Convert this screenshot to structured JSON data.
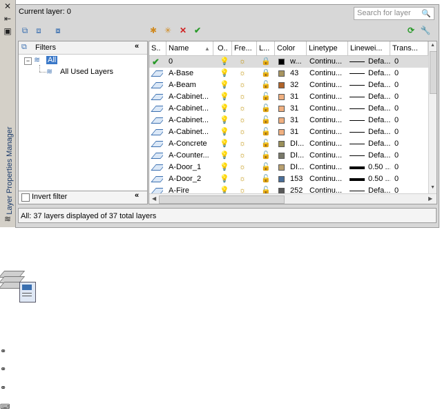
{
  "palette": {
    "title": "Layer Properties Manager",
    "close_icon": "close-icon",
    "autohide_icon": "autohide-icon",
    "properties_icon": "properties-icon"
  },
  "header": {
    "current_layer": "Current layer: 0",
    "search_placeholder": "Search for layer"
  },
  "filters": {
    "title": "Filters",
    "tree": [
      {
        "label": "All"
      },
      {
        "label": "All Used Layers"
      }
    ],
    "invert_filter": "Invert filter"
  },
  "columns": [
    "S..",
    "Name",
    "O..",
    "Fre...",
    "L...",
    "Color",
    "Linetype",
    "Linewei...",
    "Trans..."
  ],
  "layers": [
    {
      "status": "current",
      "name": "0",
      "color_label": "w...",
      "color": "#000000",
      "linetype": "Continu...",
      "lineweight": "Defa...",
      "lw_thick": false,
      "trans": "0",
      "locked": true,
      "selected": true
    },
    {
      "status": "",
      "name": "A-Base",
      "color_label": "43",
      "color": "#a89560",
      "linetype": "Continu...",
      "lineweight": "Defa...",
      "lw_thick": false,
      "trans": "0",
      "locked": true
    },
    {
      "status": "",
      "name": "A-Beam",
      "color_label": "32",
      "color": "#b0642a",
      "linetype": "Continu...",
      "lineweight": "Defa...",
      "lw_thick": false,
      "trans": "0",
      "locked": false
    },
    {
      "status": "",
      "name": "A-Cabinet...",
      "color_label": "31",
      "color": "#f0b080",
      "linetype": "Continu...",
      "lineweight": "Defa...",
      "lw_thick": false,
      "trans": "0",
      "locked": false
    },
    {
      "status": "",
      "name": "A-Cabinet...",
      "color_label": "31",
      "color": "#f0b080",
      "linetype": "Continu...",
      "lineweight": "Defa...",
      "lw_thick": false,
      "trans": "0",
      "locked": false
    },
    {
      "status": "",
      "name": "A-Cabinet...",
      "color_label": "31",
      "color": "#f0b080",
      "linetype": "Continu...",
      "lineweight": "Defa...",
      "lw_thick": false,
      "trans": "0",
      "locked": false
    },
    {
      "status": "",
      "name": "A-Cabinet...",
      "color_label": "31",
      "color": "#f0b080",
      "linetype": "Continu...",
      "lineweight": "Defa...",
      "lw_thick": false,
      "trans": "0",
      "locked": false
    },
    {
      "status": "",
      "name": "A-Concrete",
      "color_label": "DI...",
      "color": "#9a8f5a",
      "linetype": "Continu...",
      "lineweight": "Defa...",
      "lw_thick": false,
      "trans": "0",
      "locked": false
    },
    {
      "status": "",
      "name": "A-Counter...",
      "color_label": "DI...",
      "color": "#7a7a6a",
      "linetype": "Continu...",
      "lineweight": "Defa...",
      "lw_thick": false,
      "trans": "0",
      "locked": false
    },
    {
      "status": "",
      "name": "A-Door_1",
      "color_label": "DI...",
      "color": "#b8a070",
      "linetype": "Continu...",
      "lineweight": "0.50 ...",
      "lw_thick": true,
      "trans": "0",
      "locked": false
    },
    {
      "status": "",
      "name": "A-Door_2",
      "color_label": "153",
      "color": "#4a6f9a",
      "linetype": "Continu...",
      "lineweight": "0.50 ...",
      "lw_thick": true,
      "trans": "0",
      "locked": false
    },
    {
      "status": "",
      "name": "A-Fire",
      "color_label": "252",
      "color": "#5a5a5a",
      "linetype": "Continu...",
      "lineweight": "Defa...",
      "lw_thick": false,
      "trans": "0",
      "locked": false
    }
  ],
  "status_text": "All: 37 layers displayed of 37 total layers"
}
